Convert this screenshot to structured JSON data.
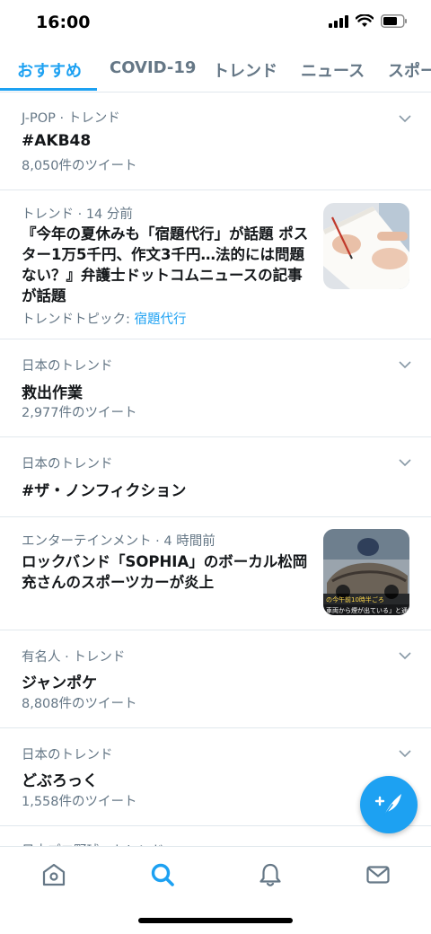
{
  "status_bar": {
    "time": "16:00"
  },
  "tabs": [
    {
      "label": "おすすめ",
      "active": true
    },
    {
      "label": "COVID-19"
    },
    {
      "label": "トレンド"
    },
    {
      "label": "ニュース"
    },
    {
      "label": "スポー"
    }
  ],
  "trends": [
    {
      "context": "J-POP · トレンド",
      "title": "#AKB48",
      "count": "8,050件のツイート"
    },
    {
      "context": "トレンド · 14 分前",
      "title": "『今年の夏休みも「宿題代行」が話題 ポスター1万5千円、作文3千円…法的には問題ない？』弁護士ドットコムニュースの記事が話題",
      "topic_label": "トレンドトピック: ",
      "topic_link": "宿題代行"
    },
    {
      "context": "日本のトレンド",
      "title": "救出作業",
      "count": "2,977件のツイート"
    },
    {
      "context": "日本のトレンド",
      "title": "#ザ・ノンフィクション"
    },
    {
      "context": "エンターテインメント · 4 時間前",
      "title": "ロックバンド「SOPHIA」のボーカル松岡充さんのスポーツカーが炎上",
      "thumb_caption_1": "の今午前10時半ごろ",
      "thumb_caption_2": "車両から煙が出ている」と通報"
    },
    {
      "context": "有名人 · トレンド",
      "title": "ジャンポケ",
      "count": "8,808件のツイート"
    },
    {
      "context": "日本のトレンド",
      "title": "どぶろっく",
      "count": "1,558件のツイート"
    },
    {
      "context": "日本プロ野球 · トレンド"
    }
  ],
  "icons": {
    "fab": "compose-tweet-icon",
    "nav": [
      "home-icon",
      "search-icon",
      "notifications-icon",
      "messages-icon"
    ]
  },
  "colors": {
    "accent": "#1da1f2",
    "secondary_text": "#657786",
    "divider": "#e1e8ed"
  }
}
